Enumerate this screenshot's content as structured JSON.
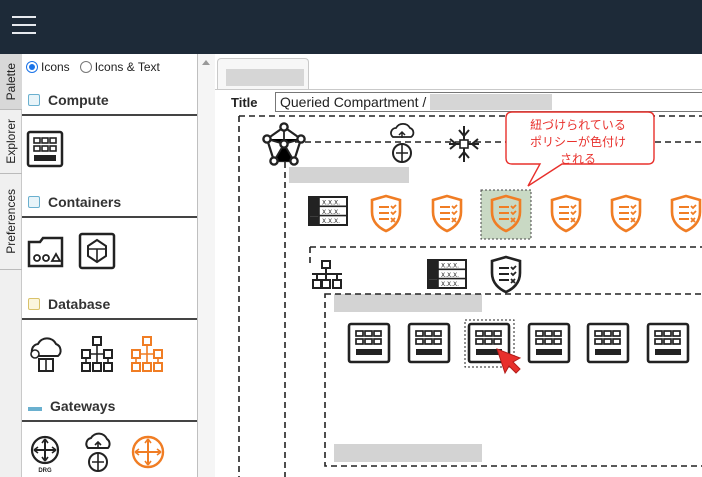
{
  "palette_tabs": [
    "Palette",
    "Explorer",
    "Preferences"
  ],
  "display_mode": {
    "icons_label": "Icons",
    "icons_text_label": "Icons & Text",
    "selected": "Icons"
  },
  "categories": [
    {
      "name": "Compute"
    },
    {
      "name": "Containers"
    },
    {
      "name": "Database"
    },
    {
      "name": "Gateways"
    }
  ],
  "gateway_drg_label": "DRG",
  "title_label": "Title",
  "title_value": "Queried Compartment /",
  "callout_text": [
    "紐づけられている",
    "ポリシーが色付け",
    "される"
  ],
  "colors": {
    "topbar": "#1d2a38",
    "accent_orange": "#f07d24",
    "callout_red": "#e8302c",
    "highlight_fill": "#c9d9c4"
  }
}
